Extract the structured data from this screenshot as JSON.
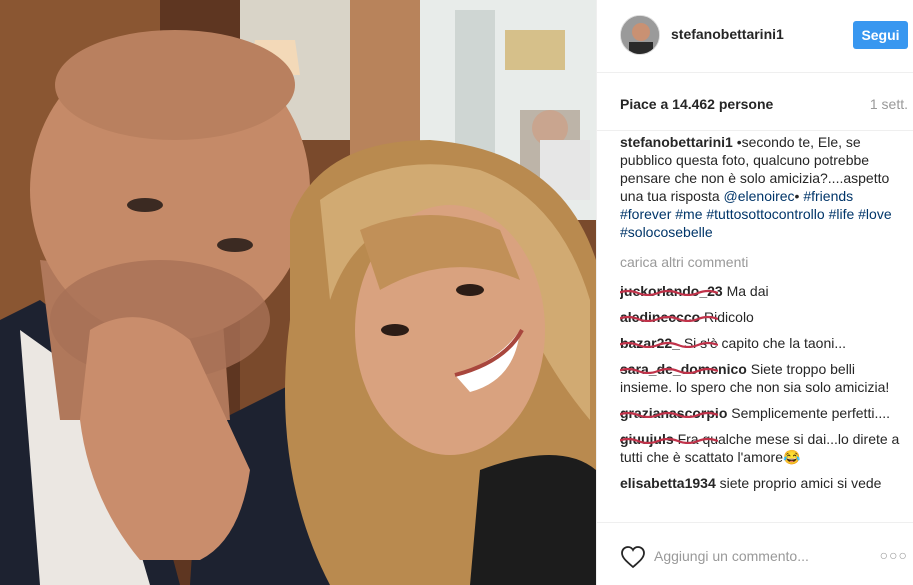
{
  "post": {
    "username": "stefanobettarini1",
    "follow_label": "Segui",
    "likes_text": "Piace a 14.462 persone",
    "time_ago": "1 sett."
  },
  "caption": {
    "username": "stefanobettarini1",
    "text": "•secondo te, Ele, se pubblico questa foto, qualcuno potrebbe pensare che non è solo amicizia?....aspetto una tua risposta",
    "mention": "@elenoirec",
    "tags_line": "• #friends #forever #me #tuttosottocontrollo #life #love #solocosebelle",
    "tag_friends": "#friends",
    "tag_forever": "#forever",
    "tag_me": "#me",
    "tag_tutto": "#tuttosottocontrollo",
    "tag_life": "#life",
    "tag_love": "#love",
    "tag_solocose": "#solocosebelle"
  },
  "load_more": "carica altri commenti",
  "comments": [
    {
      "username": "juckorlando_23",
      "text": "Ma dai"
    },
    {
      "username": "aledineccco",
      "text": "Ridicolo"
    },
    {
      "username": "bazar22_",
      "text": "Si s'è capito che la taoni..."
    },
    {
      "username": "sara_de_domenico",
      "text": "Siete troppo belli insieme. lo spero che non sia solo amicizia!"
    },
    {
      "username": "grazianascorpio",
      "text": "Semplicemente perfetti...."
    },
    {
      "username": "giuujuls",
      "text": "Fra qualche mese si dai...lo direte a tutti che è scattato l'amore😂"
    },
    {
      "username": "elisabetta1934",
      "text": "siete proprio amici si vede"
    }
  ],
  "footer": {
    "placeholder": "Aggiungi un commento...",
    "more_label": "○○○"
  },
  "icons": {
    "heart": "heart-icon",
    "more": "more-options-icon"
  },
  "colors": {
    "follow_button": "#3897f0",
    "link": "#003569",
    "muted": "#999999",
    "text": "#262626"
  }
}
